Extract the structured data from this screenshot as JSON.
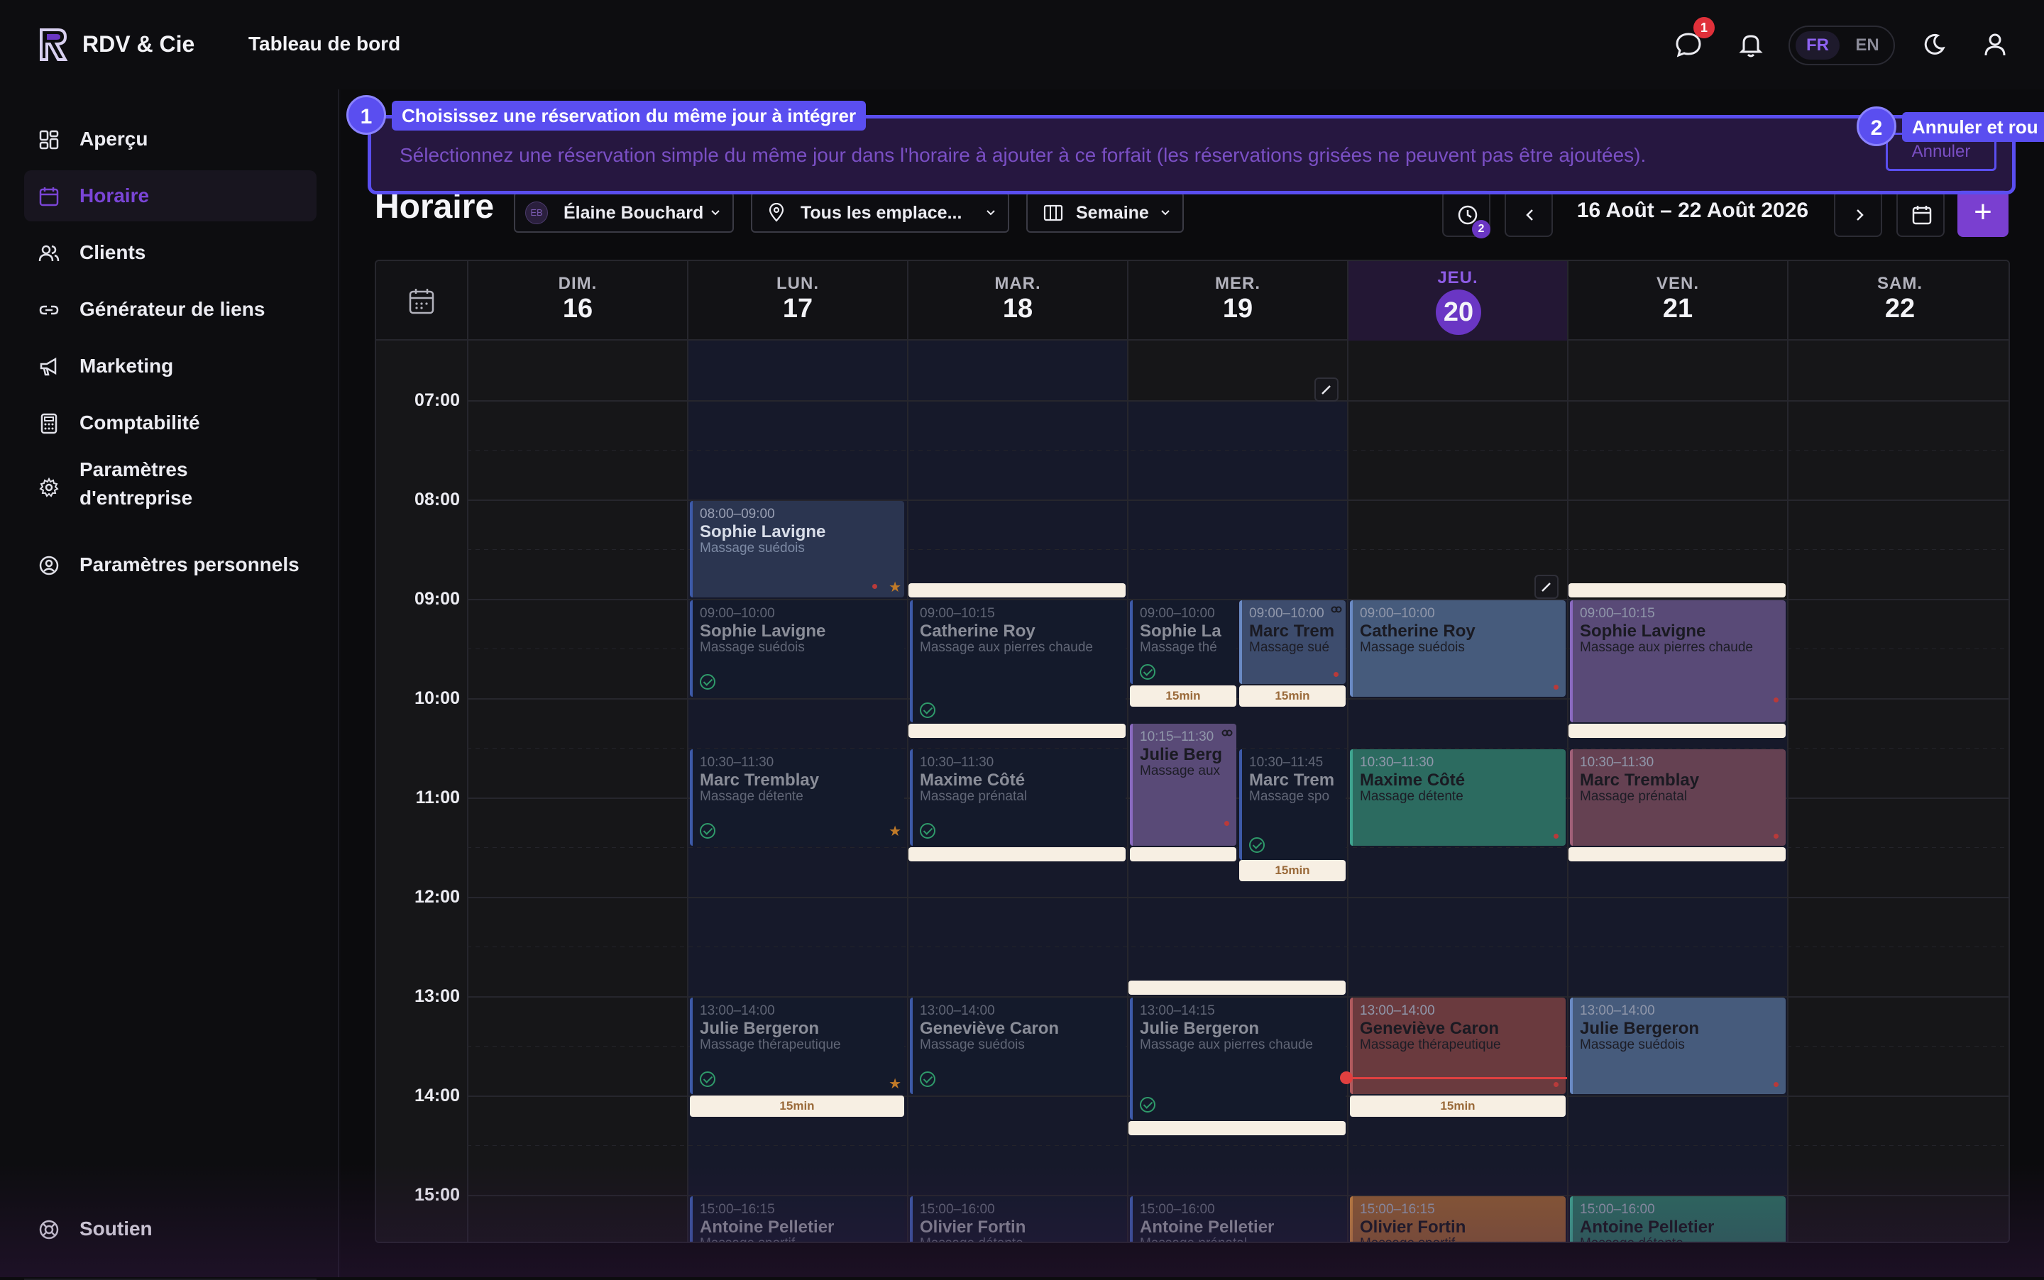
{
  "app": {
    "brand": "RDV & Cie",
    "page_title": "Tableau de bord"
  },
  "topbar": {
    "messages_badge": "1",
    "lang_fr": "FR",
    "lang_en": "EN"
  },
  "sidebar": {
    "items": [
      {
        "label": "Aperçu",
        "icon": "grid-icon"
      },
      {
        "label": "Horaire",
        "icon": "calendar-icon",
        "active": true
      },
      {
        "label": "Clients",
        "icon": "users-icon"
      },
      {
        "label": "Générateur de liens",
        "icon": "link-icon"
      },
      {
        "label": "Marketing",
        "icon": "megaphone-icon"
      },
      {
        "label": "Comptabilité",
        "icon": "calculator-icon"
      },
      {
        "label": "Paramètres d'entreprise",
        "label_line1": "Paramètres",
        "label_line2": "d'entreprise",
        "icon": "gear-icon"
      },
      {
        "label": "Paramètres personnels",
        "icon": "user-circle-icon"
      }
    ],
    "support": "Soutien"
  },
  "schedule": {
    "title": "Horaire",
    "staff_initials": "EB",
    "staff": "Élaine Bouchard",
    "location": "Tous les emplace...",
    "view": "Semaine",
    "history_badge": "2",
    "date_range": "16 Août – 22 Août 2026",
    "add": "+"
  },
  "tour": {
    "step1": "1",
    "step1_title": "Choisissez une réservation du même jour à intégrer",
    "description": "Sélectionnez une réservation simple du même jour dans l'horaire à ajouter à ce forfait (les réservations grisées ne peuvent pas être ajoutées).",
    "cancel": "Annuler",
    "step2": "2",
    "step2_title": "Annuler et rou"
  },
  "calendar": {
    "days": [
      {
        "name": "DIM.",
        "num": "16"
      },
      {
        "name": "LUN.",
        "num": "17"
      },
      {
        "name": "MAR.",
        "num": "18"
      },
      {
        "name": "MER.",
        "num": "19"
      },
      {
        "name": "JEU.",
        "num": "20",
        "today": true
      },
      {
        "name": "VEN.",
        "num": "21"
      },
      {
        "name": "SAM.",
        "num": "22"
      }
    ],
    "hours": [
      "07:00",
      "08:00",
      "09:00",
      "10:00",
      "11:00",
      "12:00",
      "13:00",
      "14:00",
      "15:00"
    ],
    "buffer_label": "15min",
    "events": [
      {
        "day": 1,
        "time": "08:00–09:00",
        "name": "Sophie Lavigne",
        "service": "Massage suédois",
        "style": "hl"
      },
      {
        "day": 1,
        "time": "09:00–10:00",
        "name": "Sophie Lavigne",
        "service": "Massage suédois",
        "style": "dim"
      },
      {
        "day": 1,
        "time": "10:30–11:30",
        "name": "Marc Tremblay",
        "service": "Massage détente",
        "style": "dim"
      },
      {
        "day": 1,
        "time": "13:00–14:00",
        "name": "Julie Bergeron",
        "service": "Massage thérapeutique",
        "style": "dim"
      },
      {
        "day": 1,
        "time": "15:00–16:15",
        "name": "Antoine Pelletier",
        "service": "Massage sportif",
        "style": "dim"
      },
      {
        "day": 2,
        "time": "09:00–10:15",
        "name": "Catherine Roy",
        "service": "Massage aux pierres chaude",
        "style": "dim"
      },
      {
        "day": 2,
        "time": "10:30–11:30",
        "name": "Maxime Côté",
        "service": "Massage prénatal",
        "style": "dim"
      },
      {
        "day": 2,
        "time": "13:00–14:00",
        "name": "Geneviève Caron",
        "service": "Massage suédois",
        "style": "dim"
      },
      {
        "day": 2,
        "time": "15:00–16:00",
        "name": "Olivier Fortin",
        "service": "Massage détente",
        "style": "dim"
      },
      {
        "day": 3,
        "time": "09:00–10:00",
        "name": "Sophie La",
        "service": "Massage thé",
        "style": "dim"
      },
      {
        "day": 3,
        "time": "09:00–10:00",
        "name": "Marc Trem",
        "service": "Massage sué",
        "style": "slate"
      },
      {
        "day": 3,
        "time": "10:15–11:30",
        "name": "Julie Berg",
        "service": "Massage aux",
        "style": "purple"
      },
      {
        "day": 3,
        "time": "10:30–11:45",
        "name": "Marc Trem",
        "service": "Massage spo",
        "style": "dim"
      },
      {
        "day": 3,
        "time": "13:00–14:15",
        "name": "Julie Bergeron",
        "service": "Massage aux pierres chaude",
        "style": "dim"
      },
      {
        "day": 3,
        "time": "15:00–16:00",
        "name": "Antoine Pelletier",
        "service": "Massage prénatal",
        "style": "dim"
      },
      {
        "day": 4,
        "time": "09:00–10:00",
        "name": "Catherine Roy",
        "service": "Massage suédois",
        "style": "blue"
      },
      {
        "day": 4,
        "time": "10:30–11:30",
        "name": "Maxime Côté",
        "service": "Massage détente",
        "style": "teal"
      },
      {
        "day": 4,
        "time": "13:00–14:00",
        "name": "Geneviève Caron",
        "service": "Massage thérapeutique",
        "style": "red"
      },
      {
        "day": 4,
        "time": "15:00–16:15",
        "name": "Olivier Fortin",
        "service": "Massage sportif",
        "style": "orange"
      },
      {
        "day": 5,
        "time": "09:00–10:15",
        "name": "Sophie Lavigne",
        "service": "Massage aux pierres chaude",
        "style": "purple"
      },
      {
        "day": 5,
        "time": "10:30–11:30",
        "name": "Marc Tremblay",
        "service": "Massage prénatal",
        "style": "rose"
      },
      {
        "day": 5,
        "time": "13:00–14:00",
        "name": "Julie Bergeron",
        "service": "Massage suédois",
        "style": "blue"
      },
      {
        "day": 5,
        "time": "15:00–16:00",
        "name": "Antoine Pelletier",
        "service": "Massage détente",
        "style": "teal"
      }
    ]
  },
  "colors": {
    "accent": "#7a3fd0",
    "tour": "#5a4ef0",
    "now": "#e04040"
  }
}
